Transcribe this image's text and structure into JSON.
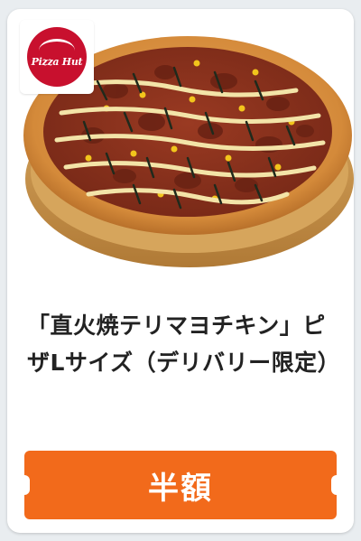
{
  "card": {
    "logo": {
      "icon": "pizza-hut-logo",
      "text": "Pizza Hut",
      "color": "#c8102e"
    },
    "title": "「直火焼テリマヨチキン」ピザLサイズ（デリバリー限定）",
    "coupon": {
      "label": "半額",
      "color": "#f26a1b"
    }
  }
}
